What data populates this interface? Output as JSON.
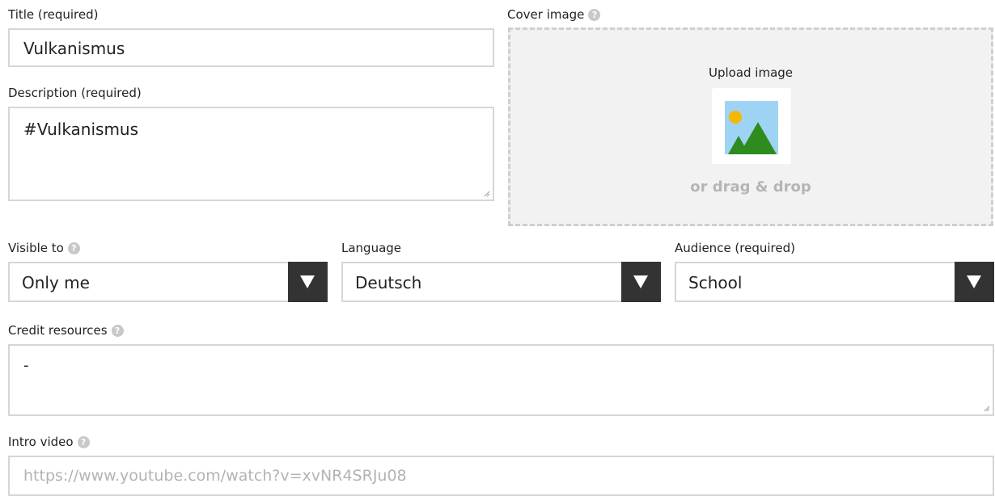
{
  "title_field": {
    "label": "Title (required)",
    "value": "Vulkanismus"
  },
  "description_field": {
    "label": "Description (required)",
    "value": "#Vulkanismus"
  },
  "cover_image": {
    "label": "Cover image",
    "upload_label": "Upload image",
    "drag_label": "or drag & drop",
    "icon": "image-placeholder-icon"
  },
  "visible_to": {
    "label": "Visible to",
    "value": "Only me"
  },
  "language": {
    "label": "Language",
    "value": "Deutsch"
  },
  "audience": {
    "label": "Audience (required)",
    "value": "School"
  },
  "credit_resources": {
    "label": "Credit resources",
    "value": "-"
  },
  "intro_video": {
    "label": "Intro video",
    "placeholder": "https://www.youtube.com/watch?v=xvNR4SRJu08"
  },
  "help_icon_glyph": "?",
  "dropdown_glyph": "▼",
  "colors": {
    "dropdown_button": "#333333",
    "border": "#d6d6d6",
    "dropzone_bg": "#f2f2f2"
  }
}
